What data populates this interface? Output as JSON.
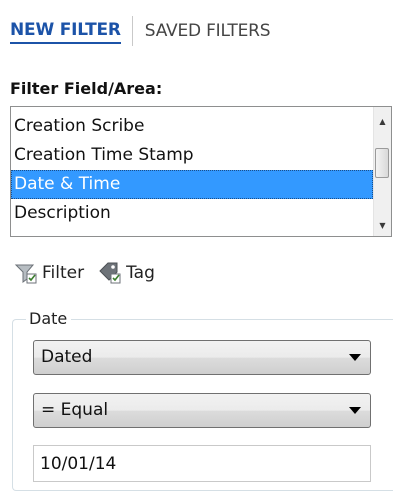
{
  "tabs": {
    "new_filter": "NEW FILTER",
    "saved_filters": "SAVED FILTERS"
  },
  "filter_field": {
    "label": "Filter Field/Area:",
    "items": [
      {
        "label": "Creation Scribe",
        "selected": false
      },
      {
        "label": "Creation Time Stamp",
        "selected": false
      },
      {
        "label": "Date & Time",
        "selected": true
      },
      {
        "label": "Description",
        "selected": false
      }
    ]
  },
  "toolbar": {
    "filter_label": "Filter",
    "filter_icon": "filter-funnel-icon",
    "tag_label": "Tag",
    "tag_icon": "tag-icon"
  },
  "date_group": {
    "legend": "Date",
    "mode_select": {
      "value": "Dated"
    },
    "operator_select": {
      "value": "= Equal"
    },
    "date_input": {
      "value": "10/01/14"
    }
  },
  "colors": {
    "active_tab": "#1c53a8",
    "selection": "#3399ff"
  }
}
